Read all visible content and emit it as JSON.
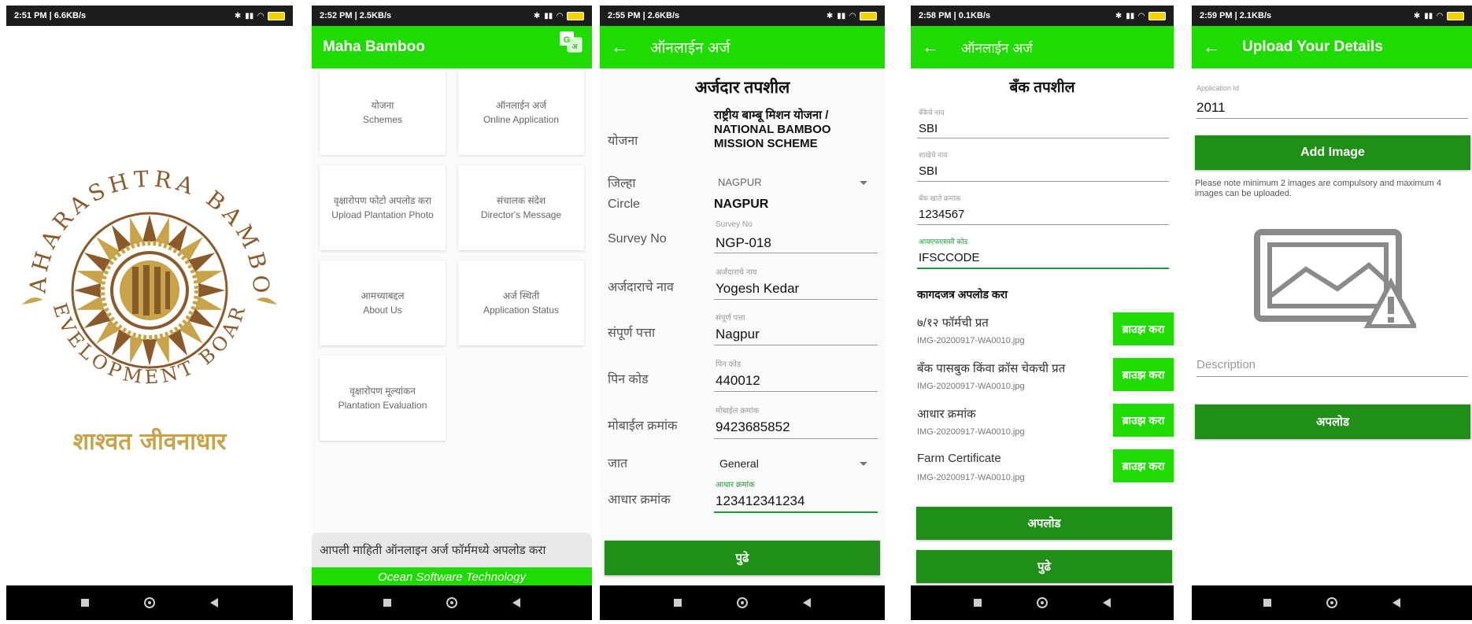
{
  "phone1": {
    "status": {
      "time": "2:51 PM | 6.6KB/s"
    },
    "logo": {
      "arc_text": "MAHARASHTRA BAMBOO DEVELOPMENT BOARD"
    },
    "tagline": "शाश्वत जीवनाधार"
  },
  "phone2": {
    "status": {
      "time": "2:52 PM | 2.5KB/s"
    },
    "app_title": "Maha Bamboo",
    "tiles": [
      {
        "mr": "योजना",
        "en": "Schemes"
      },
      {
        "mr": "ऑनलाईन अर्ज",
        "en": "Online Application"
      },
      {
        "mr": "वृक्षारोपण फोटो अपलोड करा",
        "en": "Upload Plantation Photo"
      },
      {
        "mr": "संचालक संदेश",
        "en": "Director's Message"
      },
      {
        "mr": "आमच्याबद्दल",
        "en": "About Us"
      },
      {
        "mr": "अर्ज स्थिती",
        "en": "Application Status"
      },
      {
        "mr": "वृक्षारोपण मूल्यांकन",
        "en": "Plantation Evaluation"
      }
    ],
    "footer_msg": "आपली माहिती ऑनलाइन अर्ज फॉर्ममध्ये अपलोड करा",
    "footer_company": "Ocean Software Technology"
  },
  "phone3": {
    "status": {
      "time": "2:55 PM | 2.6KB/s"
    },
    "app_title": "ऑनलाईन अर्ज",
    "section_title": "अर्जदार तपशील",
    "scheme_label": "योजना",
    "scheme_value": "राष्ट्रीय बाम्बू मिशन योजना / NATIONAL BAMBOO MISSION SCHEME",
    "district_label": "जिल्हा",
    "district_value": "NAGPUR",
    "circle_label": "Circle",
    "circle_value": "NAGPUR",
    "survey_label": "Survey No",
    "survey_hint": "Survey No",
    "survey_value": "NGP-018",
    "name_label": "अर्जदाराचे नाव",
    "name_hint": "अर्जदाराचे नाव",
    "name_value": "Yogesh Kedar",
    "address_label": "संपूर्ण पत्ता",
    "address_hint": "संपूर्ण पत्ता",
    "address_value": "Nagpur",
    "pin_label": "पिन कोड",
    "pin_hint": "पिन कोड",
    "pin_value": "440012",
    "mobile_label": "मोबाईल क्रमांक",
    "mobile_hint": "मोबाईल क्रमांक",
    "mobile_value": "9423685852",
    "caste_label": "जात",
    "caste_value": "General",
    "aadhar_label": "आधार क्रमांक",
    "aadhar_hint": "आधार क्रमांक",
    "aadhar_value": "123412341234",
    "next_button": "पुढे"
  },
  "phone4": {
    "status": {
      "time": "2:58 PM | 0.1KB/s"
    },
    "app_title": "ऑनलाईन अर्ज",
    "section_title": "बँक तपशील",
    "bank_name_hint": "बँकेचे नाव",
    "bank_name_value": "SBI",
    "branch_hint": "शाखेचे नाव",
    "branch_value": "SBI",
    "account_hint": "बँक खाते क्रमांक",
    "account_value": "1234567",
    "ifsc_hint": "आयएफएससी कोड",
    "ifsc_value": "IFSCCODE",
    "docs_title": "कागदजत्र अपलोड करा",
    "docs": [
      {
        "title": "७/१२ फॉर्मची प्रत",
        "file": "IMG-20200917-WA0010.jpg",
        "button": "ब्राउझ करा"
      },
      {
        "title": "बँक पासबुक किंवा क्रॉस चेकची प्रत",
        "file": "IMG-20200917-WA0010.jpg",
        "button": "ब्राउझ करा"
      },
      {
        "title": "आधार क्रमांक",
        "file": "IMG-20200917-WA0010.jpg",
        "button": "ब्राउझ करा"
      },
      {
        "title": "Farm Certificate",
        "file": "IMG-20200917-WA0010.jpg",
        "button": "ब्राउझ करा"
      }
    ],
    "upload_button": "अपलोड",
    "next_button": "पुढे"
  },
  "phone5": {
    "status": {
      "time": "2:59 PM | 2.1KB/s"
    },
    "app_title": "Upload Your Details",
    "app_id_hint": "Application Id",
    "app_id_value": "2011",
    "add_image_button": "Add Image",
    "note": "Please note minimum 2 images are compulsory and maximum 4 images can be uploaded.",
    "description_placeholder": "Description",
    "upload_button": "अपलोड"
  },
  "colors": {
    "primary_green": "#1fdb00",
    "dark_green_button": "#1f8f17"
  }
}
